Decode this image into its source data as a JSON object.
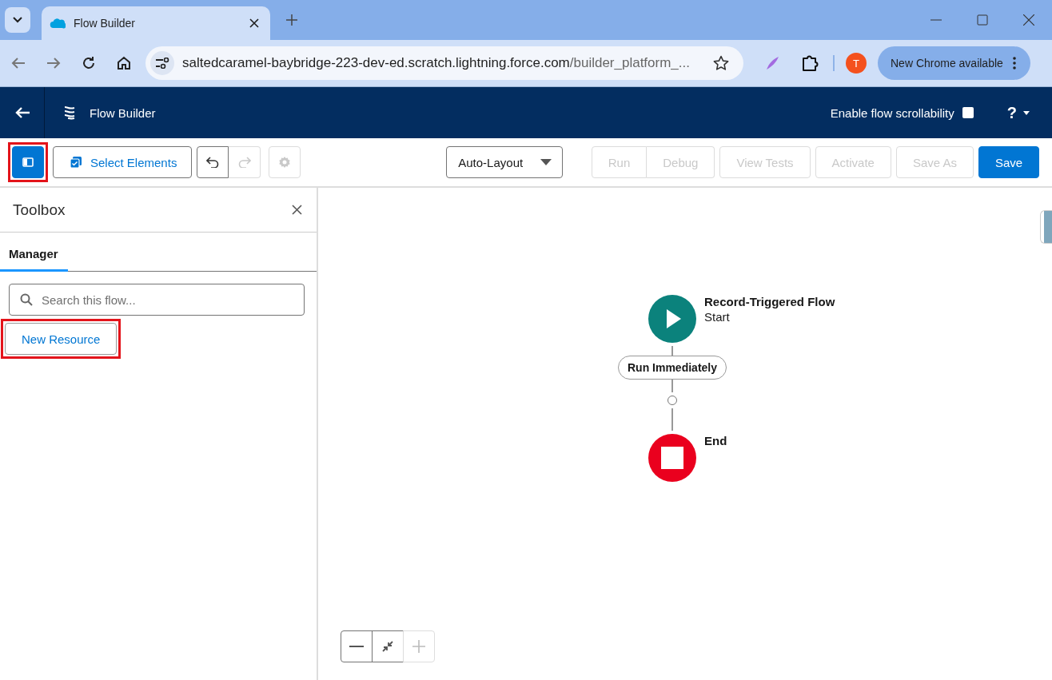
{
  "browser": {
    "tab_title": "Flow Builder",
    "url_host": "saltedcaramel-baybridge-223-dev-ed.scratch.lightning.force.com",
    "url_path": "/builder_platform_...",
    "profile_initial": "T",
    "update_label": "New Chrome available"
  },
  "app_header": {
    "title": "Flow Builder",
    "scroll_label": "Enable flow scrollability",
    "scroll_checked": false,
    "help": "?"
  },
  "toolbar": {
    "panel_toggle": {
      "highlighted": true,
      "selected": true
    },
    "select_elements": {
      "label": "Select Elements"
    },
    "history": [
      {
        "kind": "undo",
        "disabled": false
      },
      {
        "kind": "redo",
        "disabled": true
      }
    ],
    "settings": {
      "disabled": true
    },
    "layout_menu": {
      "label": "Auto-Layout"
    },
    "actions": [
      {
        "buttons": [
          {
            "label": "Run",
            "disabled": true,
            "primary": false
          },
          {
            "label": "Debug",
            "disabled": true,
            "primary": false
          }
        ]
      },
      {
        "buttons": [
          {
            "label": "View Tests",
            "disabled": true,
            "primary": false
          }
        ]
      },
      {
        "buttons": [
          {
            "label": "Activate",
            "disabled": true,
            "primary": false
          }
        ]
      },
      {
        "buttons": [
          {
            "label": "Save As",
            "disabled": true,
            "primary": false
          }
        ]
      },
      {
        "buttons": [
          {
            "label": "Save",
            "disabled": false,
            "primary": true
          }
        ]
      }
    ]
  },
  "toolbox": {
    "title": "Toolbox",
    "tabs": [
      {
        "label": "Manager",
        "selected": true
      }
    ],
    "search": {
      "placeholder": "Search this flow..."
    },
    "new_resource": {
      "label": "New Resource",
      "highlighted": true
    }
  },
  "canvas": {
    "start": {
      "title": "Record-Triggered Flow",
      "subtitle": "Start"
    },
    "path_label": "Run Immediately",
    "end": {
      "title": "End"
    },
    "zoom_controls": [
      {
        "kind": "zoom-out",
        "disabled": false
      },
      {
        "kind": "fit",
        "disabled": false
      },
      {
        "kind": "zoom-in",
        "disabled": true
      }
    ]
  }
}
